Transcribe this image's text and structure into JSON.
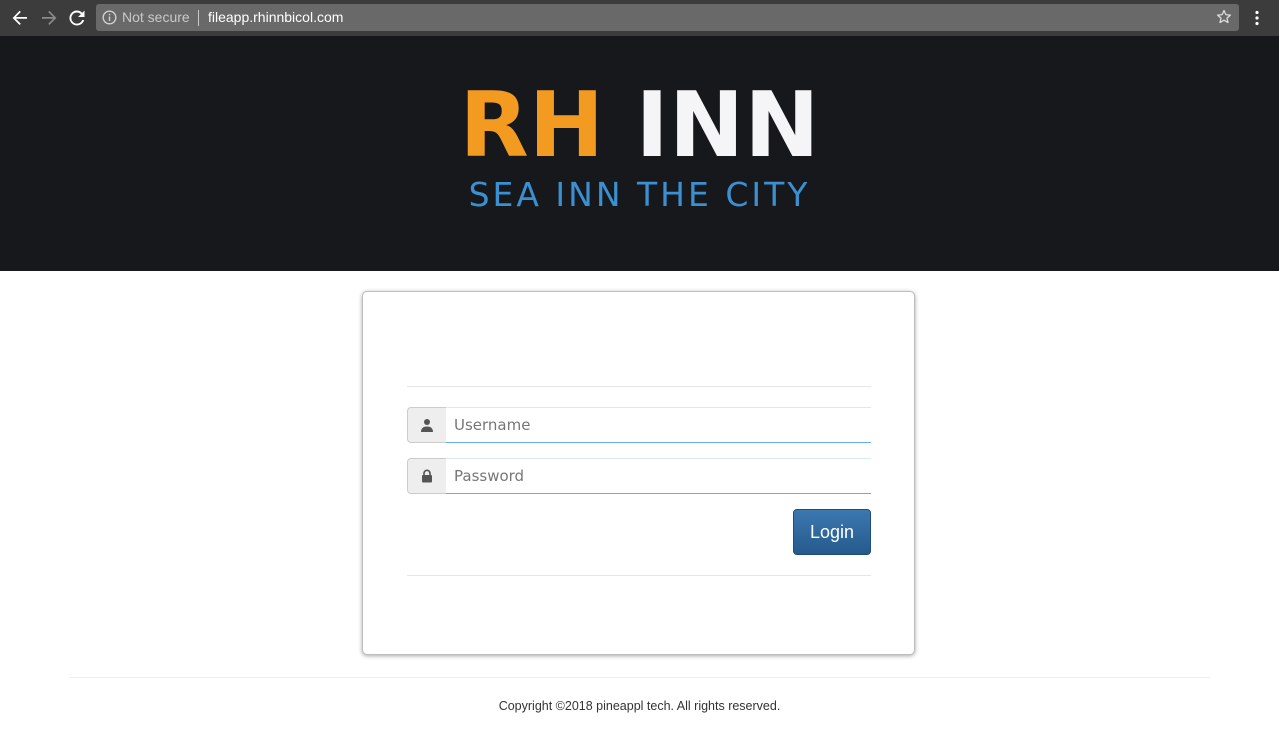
{
  "browser": {
    "back_icon": "arrow-left-icon",
    "forward_icon": "arrow-right-icon",
    "reload_icon": "reload-icon",
    "security_icon": "info-icon",
    "security_text": "Not secure",
    "url": "fileapp.rhinnbicol.com",
    "bookmark_icon": "star-icon",
    "menu_icon": "vertical-dots-icon"
  },
  "banner": {
    "logo_part1": "RH",
    "logo_part2": "INN",
    "tagline": "SEA INN THE CITY",
    "colors": {
      "background": "#17181c",
      "logo_part1": "#f39a20",
      "logo_part2": "#f5f5f7",
      "tagline": "#3a90d0"
    }
  },
  "login_form": {
    "username_icon": "user-icon",
    "username_placeholder": "Username",
    "username_value": "",
    "password_icon": "lock-icon",
    "password_placeholder": "Password",
    "password_value": "",
    "login_label": "Login",
    "login_color": "#2d6699"
  },
  "footer": {
    "copyright": "Copyright ©2018 pineappl tech. All rights reserved."
  }
}
